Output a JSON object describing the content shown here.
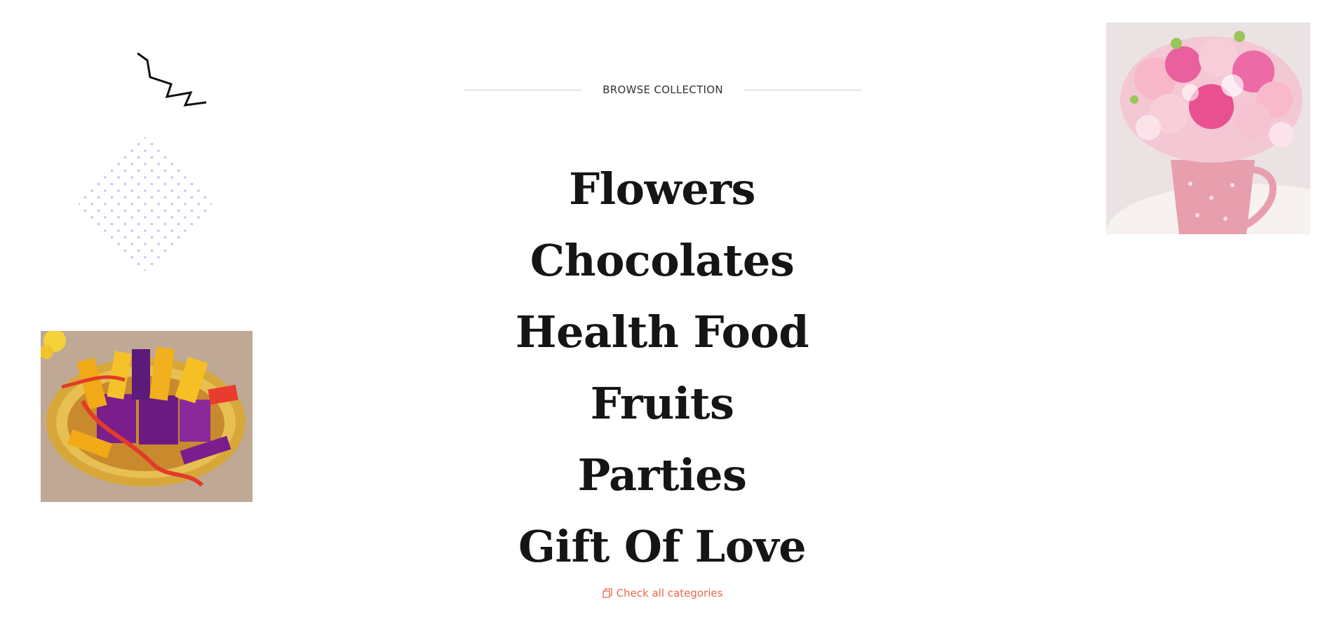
{
  "section": {
    "eyebrow": "BROWSE COLLECTION",
    "categories": [
      {
        "label": "Flowers"
      },
      {
        "label": "Chocolates"
      },
      {
        "label": "Health Food"
      },
      {
        "label": "Fruits"
      },
      {
        "label": "Parties"
      },
      {
        "label": "Gift Of Love"
      }
    ],
    "cta": {
      "label": "Check all categories",
      "icon": "copy-icon",
      "color": "#e8664a"
    }
  },
  "decor": {
    "zigzag_icon": "zigzag-icon",
    "dot_pattern_color": "#c9c4ee"
  },
  "images": [
    {
      "name": "chocolate-basket-image",
      "alt": "Chocolate gift basket"
    },
    {
      "name": "flower-vase-image",
      "alt": "Pink flower bouquet in vase"
    }
  ]
}
